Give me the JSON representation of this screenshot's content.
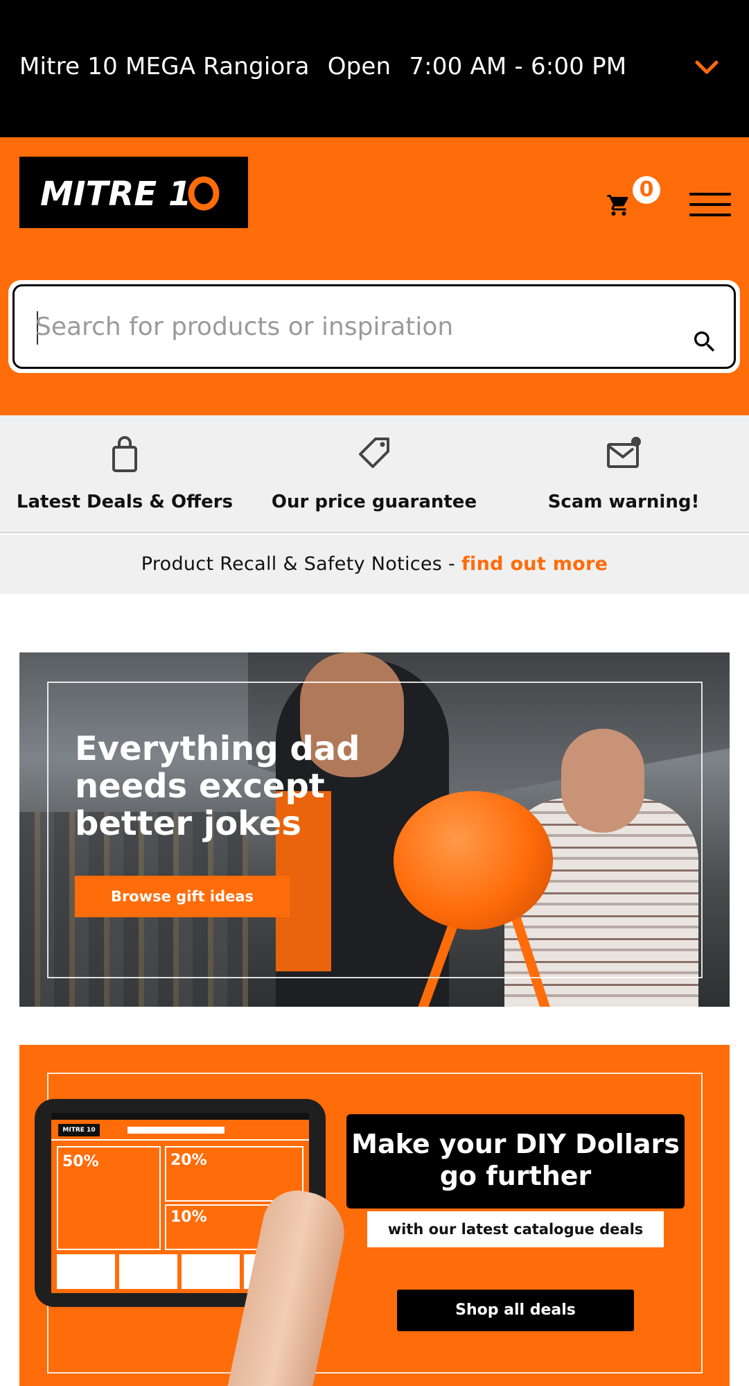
{
  "store_bar": {
    "store_name": "Mitre 10 MEGA Rangiora",
    "status": "Open",
    "hours": "7:00 AM - 6:00 PM",
    "expand_icon": "chevron-down-icon"
  },
  "header": {
    "logo_text": "MITRE 10",
    "cart_count": "0",
    "cart_icon": "cart-icon",
    "menu_icon": "hamburger-menu-icon",
    "brand_color": "#ff6c0a"
  },
  "search": {
    "placeholder": "Search for products or inspiration",
    "value": "",
    "icon": "search-icon"
  },
  "quick_links": [
    {
      "label": "Latest Deals & Offers",
      "icon": "shopping-bag-icon"
    },
    {
      "label": "Our price guarantee",
      "icon": "price-tag-icon"
    },
    {
      "label": "Scam warning!",
      "icon": "mail-notification-icon"
    }
  ],
  "recall": {
    "text": "Product Recall & Safety Notices - ",
    "link": "find out more"
  },
  "banners": [
    {
      "headline": "Everything dad needs except better jokes",
      "button": "Browse gift ideas"
    },
    {
      "headline": "Make your DIY Dollars go further",
      "subheadline": "with our latest catalogue deals",
      "button": "Shop all deals",
      "tablet_logo": "MITRE 10",
      "tablet_offers": [
        "50%",
        "20%",
        "10%"
      ]
    }
  ]
}
